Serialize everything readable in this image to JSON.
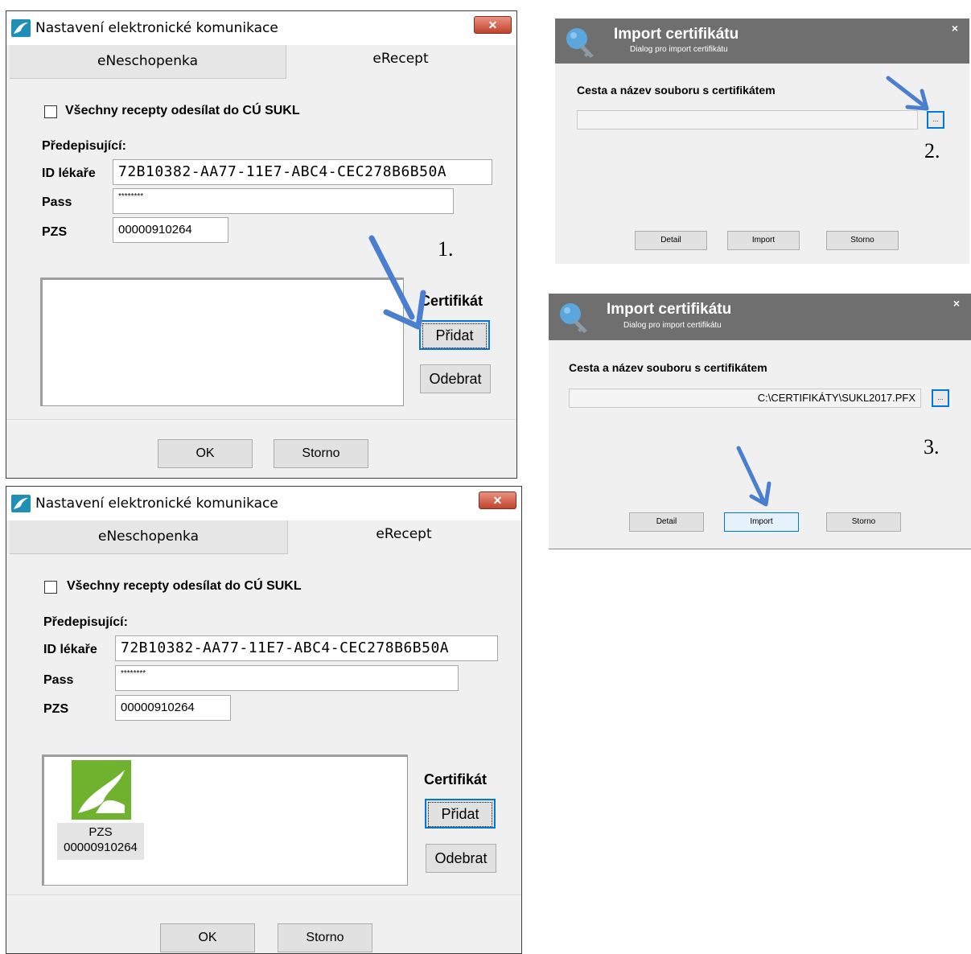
{
  "settings_window_1": {
    "title": "Nastavení elektronické komunikace",
    "close_label": "✕",
    "tabs": [
      "eNeschopenka",
      "eRecept"
    ],
    "checkbox_label": "Všechny recepty odesílat do CÚ SUKL",
    "section_label": "Předepisující:",
    "id_label": "ID lékaře",
    "id_value": "72B10382-AA77-11E7-ABC4-CEC278B6B50A",
    "pass_label": "Pass",
    "pass_value": "********",
    "pzs_label": "PZS",
    "pzs_value": "00000910264",
    "cert_label": "Certifikát",
    "add_button": "Přidat",
    "remove_button": "Odebrat",
    "ok_button": "OK",
    "cancel_button": "Storno",
    "step": "1."
  },
  "settings_window_2": {
    "title": "Nastavení elektronické komunikace",
    "close_label": "✕",
    "tabs": [
      "eNeschopenka",
      "eRecept"
    ],
    "checkbox_label": "Všechny recepty odesílat do CÚ SUKL",
    "section_label": "Předepisující:",
    "id_label": "ID lékaře",
    "id_value": "72B10382-AA77-11E7-ABC4-CEC278B6B50A",
    "pass_label": "Pass",
    "pass_value": "********",
    "pzs_label": "PZS",
    "pzs_value": "00000910264",
    "cert_item_label": "PZS",
    "cert_item_value": "00000910264",
    "cert_label": "Certifikát",
    "add_button": "Přidat",
    "remove_button": "Odebrat",
    "ok_button": "OK",
    "cancel_button": "Storno"
  },
  "import_dialog_1": {
    "title": "Import certifikátu",
    "subtitle": "Dialog pro import certifikátu",
    "close_label": "×",
    "path_label": "Cesta a název souboru s certifikátem",
    "path_value": "",
    "browse_label": "...",
    "buttons": [
      "Detail",
      "Import",
      "Storno"
    ],
    "step": "2."
  },
  "import_dialog_2": {
    "title": "Import certifikátu",
    "subtitle": "Dialog pro import certifikátu",
    "close_label": "×",
    "path_label": "Cesta a název souboru s certifikátem",
    "path_value": "C:\\CERTIFIKÁTY\\SUKL2017.PFX",
    "browse_label": "...",
    "buttons": [
      "Detail",
      "Import",
      "Storno"
    ],
    "step": "3."
  },
  "colors": {
    "arrow": "#4a7fd0",
    "focus": "#0078d7",
    "dialog_header": "#6f6f6f",
    "logo_green": "#6fb22e"
  }
}
